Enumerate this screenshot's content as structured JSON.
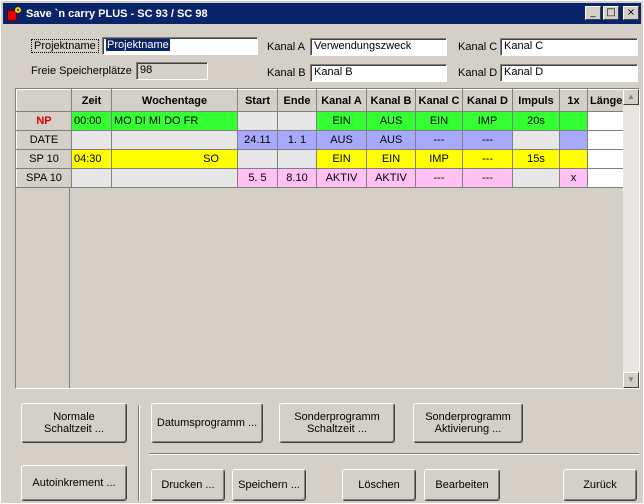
{
  "window": {
    "title": "Save `n carry PLUS - SC 93 / SC 98",
    "minimize": "_",
    "maximize": "□",
    "close": "×"
  },
  "header": {
    "projektname_label": "Projektname",
    "projektname_value": "Projektname",
    "speicher_label": "Freie Speicherplätze",
    "speicher_value": "98",
    "kanal_a_label": "Kanal A",
    "kanal_a_value": "Verwendungszweck",
    "kanal_b_label": "Kanal B",
    "kanal_b_value": "Kanal B",
    "kanal_c_label": "Kanal C",
    "kanal_c_value": "Kanal C",
    "kanal_d_label": "Kanal D",
    "kanal_d_value": "Kanal D"
  },
  "grid": {
    "columns": [
      "Zeit",
      "Wochentage",
      "Start",
      "Ende",
      "Kanal A",
      "Kanal B",
      "Kanal C",
      "Kanal D",
      "Impuls",
      "1x",
      "Länge"
    ],
    "rows": [
      {
        "head": "NP",
        "cells": [
          "00:00",
          "MO DI MI DO FR",
          "",
          "",
          "EIN",
          "AUS",
          "EIN",
          "IMP",
          "20s",
          "",
          ""
        ]
      },
      {
        "head": "DATE",
        "cells": [
          "",
          "",
          "24.11",
          "1. 1",
          "AUS",
          "AUS",
          "---",
          "---",
          "",
          "",
          ""
        ]
      },
      {
        "head": "SP 10",
        "cells": [
          "04:30",
          "SO",
          "",
          "",
          "EIN",
          "EIN",
          "IMP",
          "---",
          "15s",
          "",
          ""
        ]
      },
      {
        "head": "SPA 10",
        "cells": [
          "",
          "",
          "5. 5",
          "8.10",
          "AKTIV",
          "AKTIV",
          "---",
          "---",
          "",
          "x",
          ""
        ]
      }
    ]
  },
  "buttons": {
    "normale": "Normale\nSchaltzeit ...",
    "datums": "Datumsprogramm ...",
    "sonder_schalt": "Sonderprogramm\nSchaltzeit ...",
    "sonder_akt": "Sonderprogramm\nAktivierung ...",
    "autoinkrement": "Autoinkrement ...",
    "drucken": "Drucken ...",
    "speichern": "Speichern ...",
    "loeschen": "Löschen",
    "bearbeiten": "Bearbeiten",
    "zurueck": "Zurück"
  },
  "colors": {
    "titlebar": "#0a246a",
    "green": "#33ff33",
    "blue": "#a8a8ff",
    "yellow": "#ffff00",
    "pink": "#ffc0f4"
  }
}
